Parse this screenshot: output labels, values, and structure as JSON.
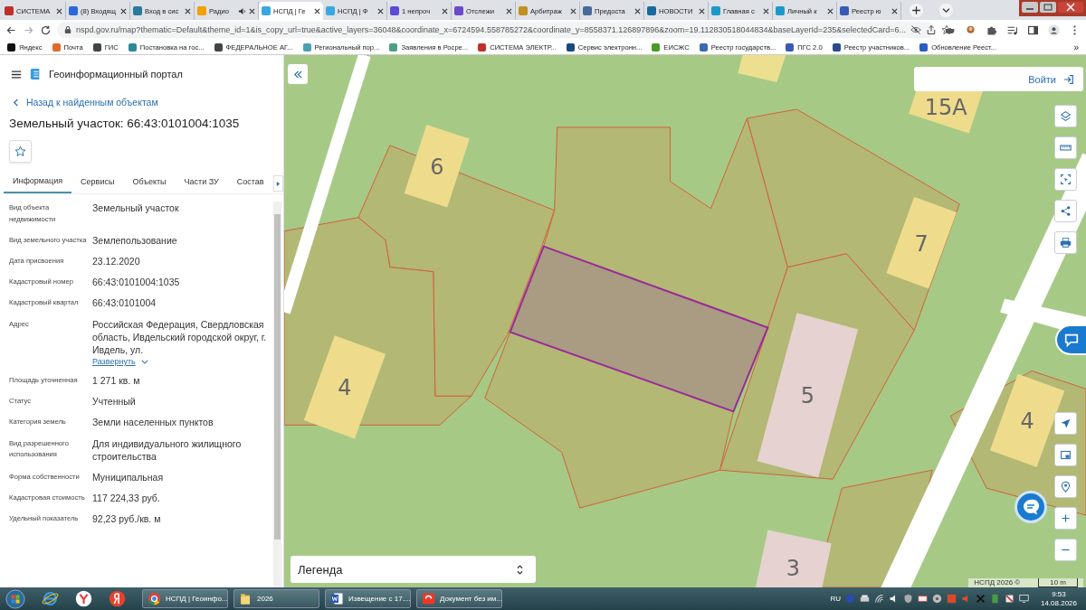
{
  "browser": {
    "tabs": [
      {
        "title": "СИСТЕМА",
        "selected": false,
        "color": "#c0302a",
        "audio": false
      },
      {
        "title": "(8) Входящ",
        "selected": false,
        "color": "#2a6ad8",
        "audio": false
      },
      {
        "title": "Вход в сис",
        "selected": false,
        "color": "#2a7a9a",
        "audio": false
      },
      {
        "title": "Радио",
        "selected": false,
        "color": "#f0a000",
        "audio": true
      },
      {
        "title": "НСПД | Ге",
        "selected": true,
        "color": "#3aa8e0",
        "audio": false
      },
      {
        "title": "НСПД | Ф",
        "selected": false,
        "color": "#3aa8e0",
        "audio": false
      },
      {
        "title": "1 непроч",
        "selected": false,
        "color": "#5a4ad8",
        "audio": false
      },
      {
        "title": "Отслежи",
        "selected": false,
        "color": "#6a4ac8",
        "audio": false
      },
      {
        "title": "Арбитраж",
        "selected": false,
        "color": "#c09020",
        "audio": false
      },
      {
        "title": "Предоста",
        "selected": false,
        "color": "#4a6a9a",
        "audio": false
      },
      {
        "title": "НОВОСТИ",
        "selected": false,
        "color": "#1a6aa0",
        "audio": false
      },
      {
        "title": "Главная с",
        "selected": false,
        "color": "#1a9ac8",
        "audio": false
      },
      {
        "title": "Личный к",
        "selected": false,
        "color": "#1a9ac8",
        "audio": false
      },
      {
        "title": "Реестр ю",
        "selected": false,
        "color": "#3a5ab8",
        "audio": false
      }
    ],
    "address": "nspd.gov.ru/map?thematic=Default&theme_id=1&is_copy_url=true&active_layers=36048&coordinate_x=6724594.558785272&coordinate_y=8558371.126897896&zoom=19.112830518044834&baseLayerId=235&selectedCard=6...",
    "bookmarks": [
      {
        "label": "Яндекс",
        "color": "#111111"
      },
      {
        "label": "Почта",
        "color": "#e06a2a"
      },
      {
        "label": "ГИС",
        "color": "#444444"
      },
      {
        "label": "Постановка на гос...",
        "color": "#2a8a9a"
      },
      {
        "label": "ФЕДЕРАЛЬНОЕ АГ...",
        "color": "#444444"
      },
      {
        "label": "Региональный пор...",
        "color": "#4aa0b0"
      },
      {
        "label": "Заявления в Росре...",
        "color": "#4aa080"
      },
      {
        "label": "СИСТЕМА ЭЛЕКТР...",
        "color": "#c0302a"
      },
      {
        "label": "Сервис электронн...",
        "color": "#1a4a7a"
      },
      {
        "label": "ЕИСЖС",
        "color": "#4a9a2a"
      },
      {
        "label": "Реестр государств...",
        "color": "#3a6ab0"
      },
      {
        "label": "ПГС 2.0",
        "color": "#3a5ab8"
      },
      {
        "label": "Реестр участников...",
        "color": "#2a4a8a"
      },
      {
        "label": "Обновление Реест...",
        "color": "#2a5ac8"
      }
    ],
    "more": "»"
  },
  "portal": {
    "title": "Геоинформационный портал",
    "back": "Назад к найденным объектам",
    "heading": "Земельный участок: 66:43:0101004:1035",
    "tabs": [
      {
        "label": "Информация",
        "selected": true
      },
      {
        "label": "Сервисы",
        "selected": false
      },
      {
        "label": "Объекты",
        "selected": false
      },
      {
        "label": "Части ЗУ",
        "selected": false
      },
      {
        "label": "Состав",
        "selected": false
      }
    ],
    "properties": [
      {
        "label": "Вид объекта недвижимости",
        "value": "Земельный участок"
      },
      {
        "label": "Вид земельного участка",
        "value": "Землепользование"
      },
      {
        "label": "Дата присвоения",
        "value": "23.12.2020"
      },
      {
        "label": "Кадастровый номер",
        "value": "66:43:0101004:1035"
      },
      {
        "label": "Кадастровый квартал",
        "value": "66:43:0101004"
      },
      {
        "label": "Адрес",
        "value": "Российская Федерация, Свердловская область, Ивдельский городской округ, г. Ивдель, ул.",
        "expand_link": "Развернуть"
      },
      {
        "label": "Площадь уточненная",
        "value": "1 271 кв. м"
      },
      {
        "label": "Статус",
        "value": "Учтенный"
      },
      {
        "label": "Категория земель",
        "value": "Земли населенных пунктов"
      },
      {
        "label": "Вид разрешенного использования",
        "value": "Для индивидуального жилищного строительства"
      },
      {
        "label": "Форма собственности",
        "value": "Муниципальная"
      },
      {
        "label": "Кадастровая стоимость",
        "value": "117 224,33 руб."
      },
      {
        "label": "Удельный показатель",
        "value": "92,23 руб./кв. м"
      }
    ]
  },
  "map": {
    "login": "Войти",
    "legend": "Легенда",
    "attribution": "НСПД 2026 ©",
    "scale": "10 m",
    "house_numbers": [
      "15А",
      "6",
      "7",
      "4",
      "5",
      "4",
      "3"
    ]
  },
  "taskbar": {
    "windows": [
      {
        "label": "НСПД | Геоинфо...",
        "kind": "chrome"
      },
      {
        "label": "2026",
        "kind": "folder"
      },
      {
        "label": "Извещение с 17....",
        "kind": "word"
      },
      {
        "label": "Документ без им...",
        "kind": "pdf"
      }
    ],
    "language": "RU",
    "time": "9:53",
    "date": "14.08.2026"
  }
}
